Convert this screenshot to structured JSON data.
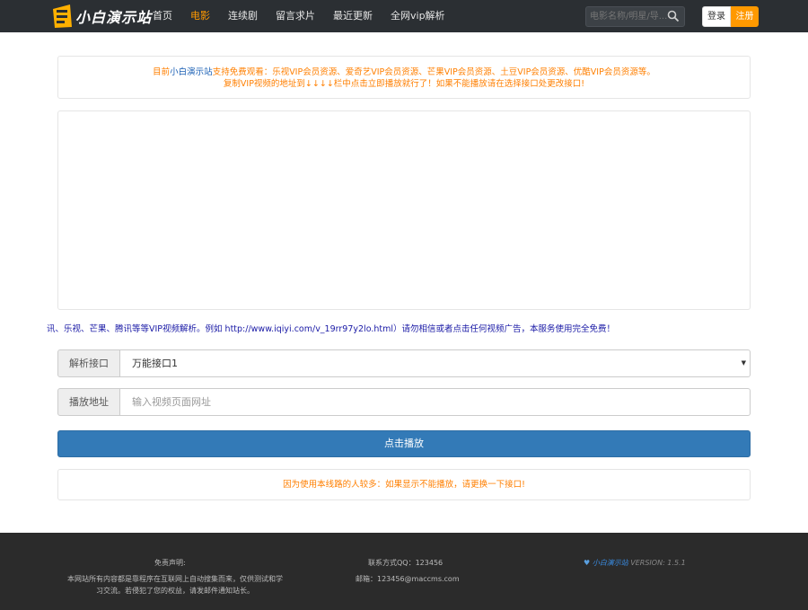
{
  "header": {
    "logo_text": "小白演示站",
    "nav": [
      {
        "label": "首页",
        "active": false
      },
      {
        "label": "电影",
        "active": true
      },
      {
        "label": "连续剧",
        "active": false
      },
      {
        "label": "留言求片",
        "active": false
      },
      {
        "label": "最近更新",
        "active": false
      },
      {
        "label": "全网vip解析",
        "active": false
      }
    ],
    "search_placeholder": "电影名称/明星/导...",
    "login_label": "登录",
    "register_label": "注册",
    "accent_color": "#ff9900"
  },
  "notice": {
    "prefix": "目前",
    "site_name": "小白演示站",
    "line1_rest": "支持免费观看：乐视VIP会员资源、爱奇艺VIP会员资源、芒果VIP会员资源、土豆VIP会员资源、优酷VIP会员资源等。",
    "line2": "复制VIP视频的地址到↓↓↓↓栏中点击立即播放就行了！如果不能播放请在选择接口处更改接口!"
  },
  "marquee_text": "讯、乐视、芒果、腾讯等等VIP视频解析。例如 http://www.iqiyi.com/v_19rr97y2lo.html）请勿相信或者点击任何视频广告，本服务使用完全免费！",
  "form": {
    "interface_label": "解析接口",
    "interface_selected": "万能接口1",
    "url_label": "播放地址",
    "url_placeholder": "输入视频页面网址",
    "play_button": "点击播放"
  },
  "tip_text": "因为使用本线路的人较多：如果显示不能播放，请更换一下接口!",
  "footer": {
    "disclaimer_title": "免责声明:",
    "disclaimer_text": "本网站所有内容都是靠程序在互联网上自动搜集而来，仅供测试和学习交流。若侵犯了您的权益，请发邮件通知站长。",
    "qq": "联系方式QQ：123456",
    "email": "邮箱：123456@maccms.com",
    "site_name": "小白演示站",
    "version": "VERSION: 1.5.1"
  }
}
